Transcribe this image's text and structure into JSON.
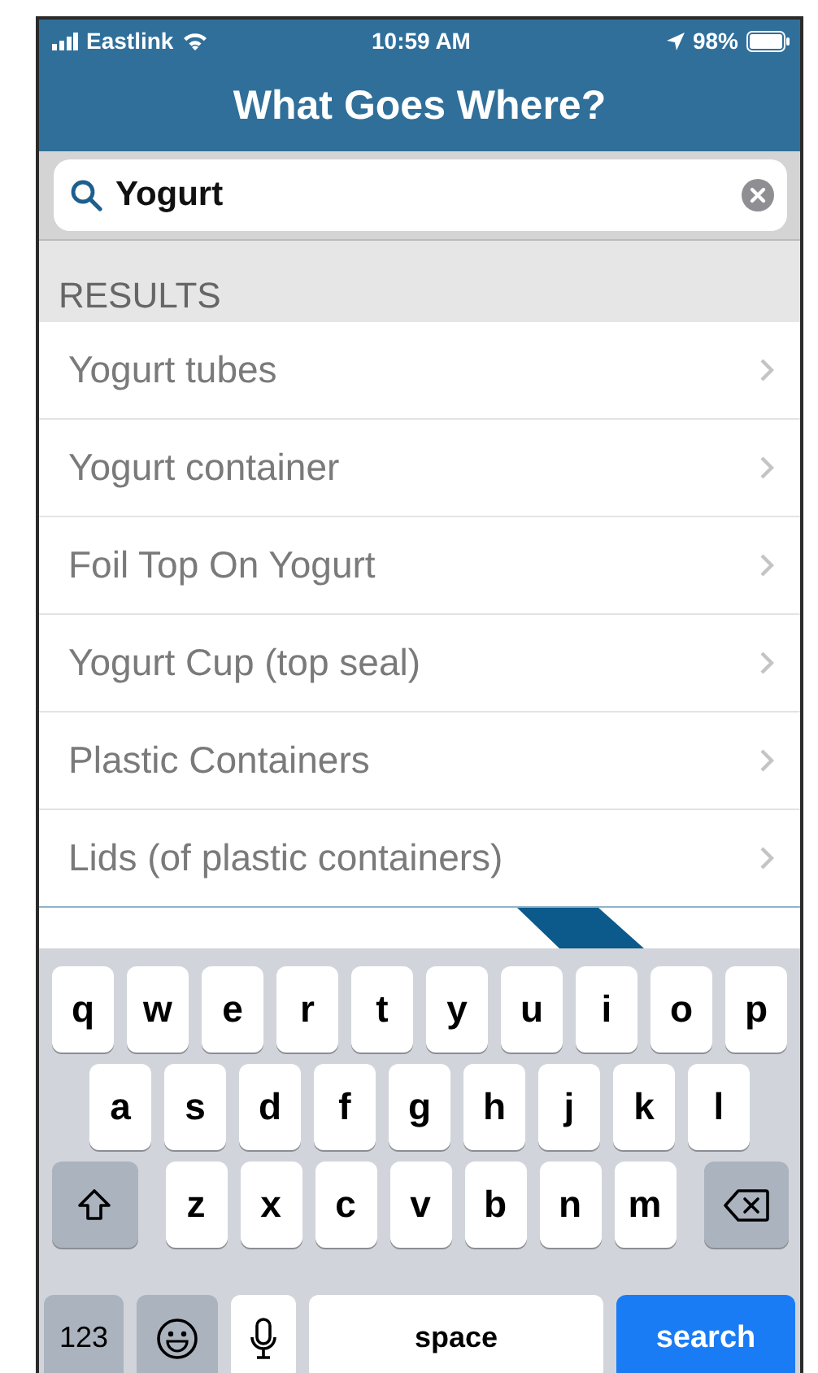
{
  "status_bar": {
    "carrier": "Eastlink",
    "time": "10:59 AM",
    "battery": "98%"
  },
  "header": {
    "title": "What Goes Where?"
  },
  "search": {
    "value": "Yogurt"
  },
  "results": {
    "heading": "RESULTS",
    "items": [
      {
        "label": "Yogurt tubes"
      },
      {
        "label": "Yogurt container"
      },
      {
        "label": "Foil Top On Yogurt"
      },
      {
        "label": "Yogurt Cup (top seal)"
      },
      {
        "label": "Plastic Containers"
      },
      {
        "label": "Lids (of plastic containers)"
      }
    ]
  },
  "keyboard": {
    "rows": [
      [
        {
          "kind": "letter",
          "label": "q"
        },
        {
          "kind": "letter",
          "label": "w"
        },
        {
          "kind": "letter",
          "label": "e"
        },
        {
          "kind": "letter",
          "label": "r"
        },
        {
          "kind": "letter",
          "label": "t"
        },
        {
          "kind": "letter",
          "label": "y"
        },
        {
          "kind": "letter",
          "label": "u"
        },
        {
          "kind": "letter",
          "label": "i"
        },
        {
          "kind": "letter",
          "label": "o"
        },
        {
          "kind": "letter",
          "label": "p"
        }
      ],
      [
        {
          "kind": "letter",
          "label": "a"
        },
        {
          "kind": "letter",
          "label": "s"
        },
        {
          "kind": "letter",
          "label": "d"
        },
        {
          "kind": "letter",
          "label": "f"
        },
        {
          "kind": "letter",
          "label": "g"
        },
        {
          "kind": "letter",
          "label": "h"
        },
        {
          "kind": "letter",
          "label": "j"
        },
        {
          "kind": "letter",
          "label": "k"
        },
        {
          "kind": "letter",
          "label": "l"
        }
      ],
      [
        {
          "kind": "shift"
        },
        {
          "kind": "letter",
          "label": "z"
        },
        {
          "kind": "letter",
          "label": "x"
        },
        {
          "kind": "letter",
          "label": "c"
        },
        {
          "kind": "letter",
          "label": "v"
        },
        {
          "kind": "letter",
          "label": "b"
        },
        {
          "kind": "letter",
          "label": "n"
        },
        {
          "kind": "letter",
          "label": "m"
        },
        {
          "kind": "delete"
        }
      ]
    ],
    "bottom_row": {
      "numbers_key": "123",
      "space_key": "space",
      "action_key": "search"
    }
  }
}
